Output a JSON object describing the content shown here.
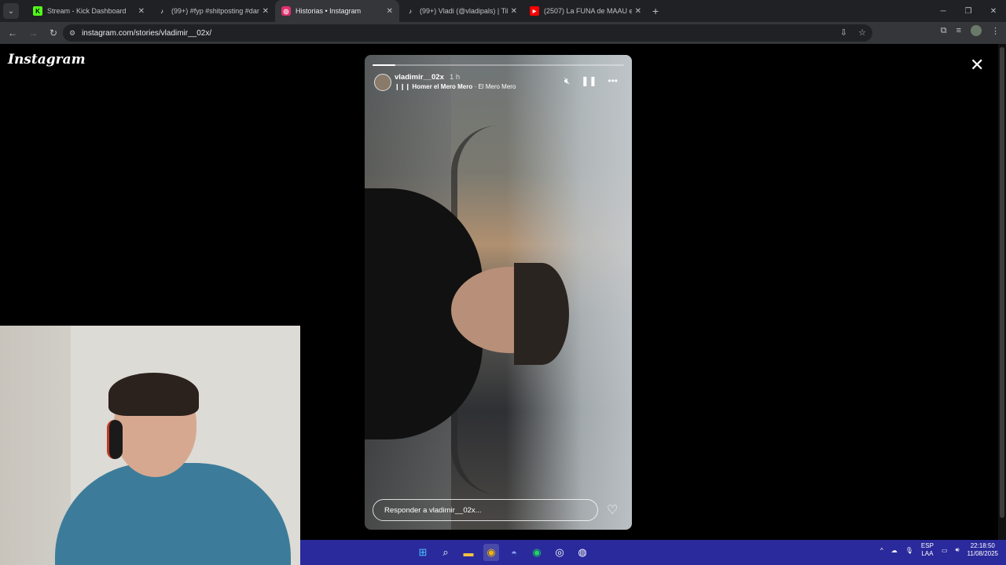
{
  "browser": {
    "tabs": [
      {
        "title": "Stream - Kick Dashboard",
        "favicon": "kick-icon",
        "color": "#53fc18",
        "active": false
      },
      {
        "title": "(99+) #fyp #shitposting #dankm",
        "favicon": "tiktok-icon",
        "color": "#000000",
        "active": false
      },
      {
        "title": "Historias • Instagram",
        "favicon": "instagram-icon",
        "color": "#e1306c",
        "active": true
      },
      {
        "title": "(99+) Vladi (@vladipals) | TikTok",
        "favicon": "tiktok-icon",
        "color": "#000000",
        "active": false
      },
      {
        "title": "(2507) La FUNA de MAAU es DE",
        "favicon": "youtube-icon",
        "color": "#ff0000",
        "active": false
      }
    ],
    "url": "instagram.com/stories/vladimir__02x/"
  },
  "page": {
    "logo": "Instagram"
  },
  "story": {
    "username": "vladimir__02x",
    "time": "1 h",
    "song": "Homer el Mero Mero",
    "artist": "El Mero Mero",
    "progress": 0.09,
    "reply_placeholder": "Responder a vladimir__02x..."
  },
  "taskbar": {
    "lang_top": "ESP",
    "lang_bottom": "LAA",
    "time": "22:18:50",
    "date": "11/08/2025"
  },
  "colors": {
    "taskbar": "#2a2a9c",
    "page_bg": "#000000",
    "chrome_dark": "#202124"
  }
}
